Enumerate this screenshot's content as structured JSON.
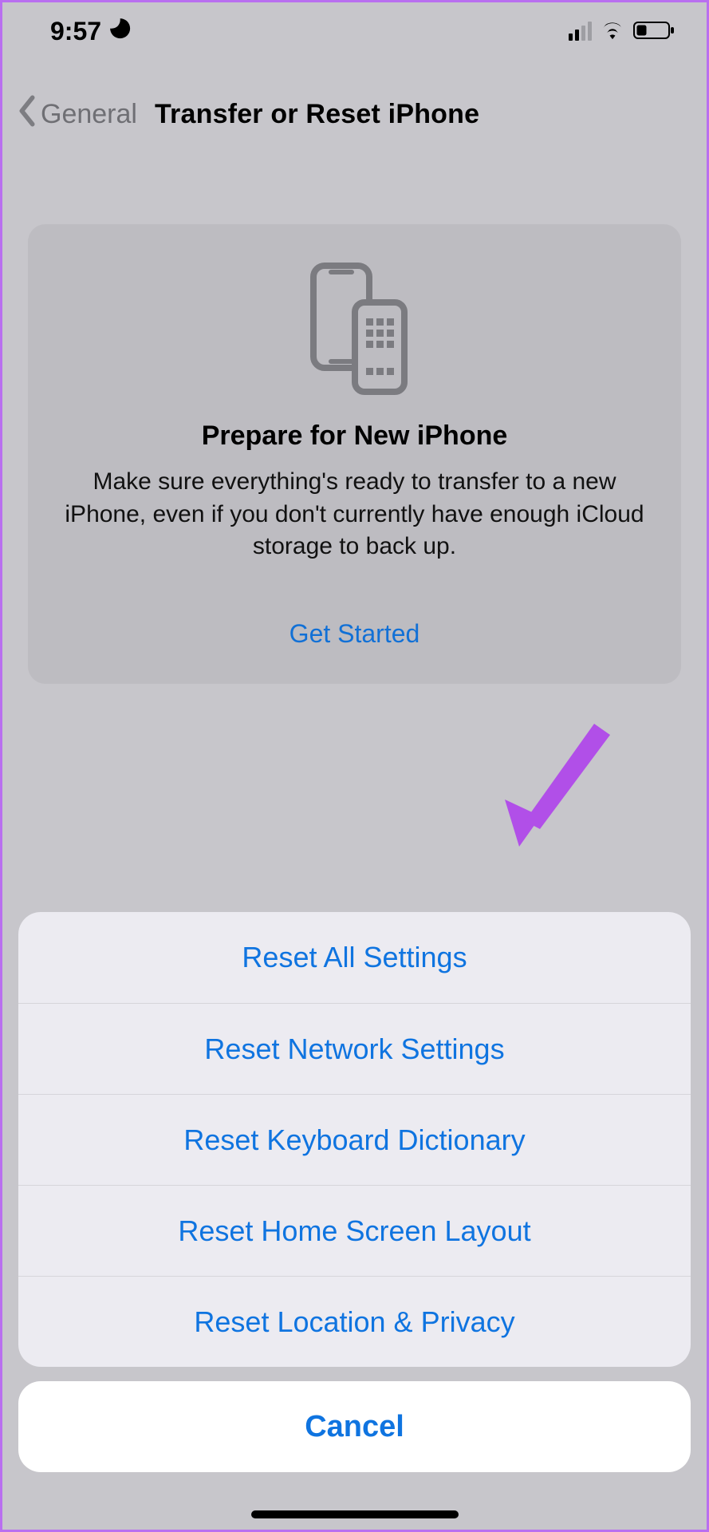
{
  "colors": {
    "accent": "#0f74e0",
    "annotation": "#b14fe8"
  },
  "statusbar": {
    "time": "9:57"
  },
  "nav": {
    "back_label": "General",
    "title": "Transfer or Reset iPhone"
  },
  "card": {
    "title": "Prepare for New iPhone",
    "description": "Make sure everything's ready to transfer to a new iPhone, even if you don't currently have enough iCloud storage to back up.",
    "cta": "Get Started"
  },
  "sheet": {
    "options": [
      "Reset All Settings",
      "Reset Network Settings",
      "Reset Keyboard Dictionary",
      "Reset Home Screen Layout",
      "Reset Location & Privacy"
    ],
    "cancel": "Cancel"
  },
  "annotation": {
    "target_option_index": 0
  }
}
